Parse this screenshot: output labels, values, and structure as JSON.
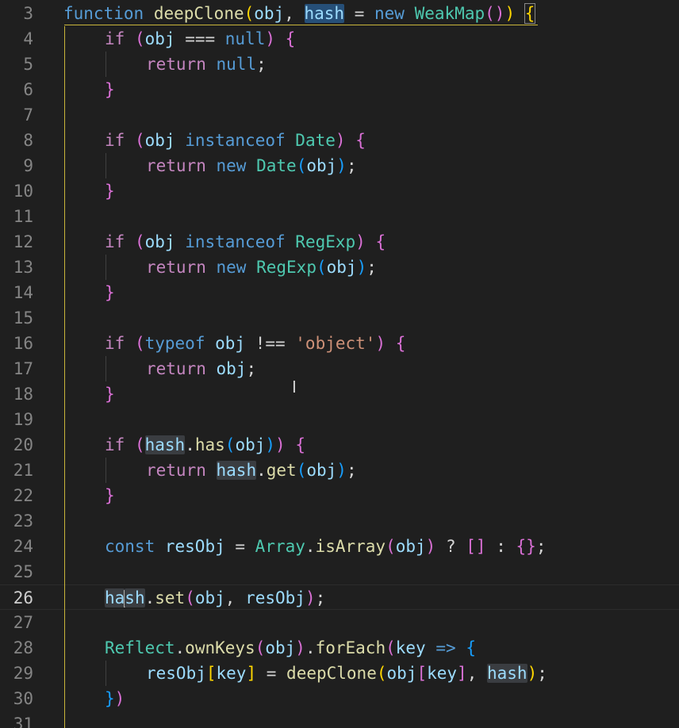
{
  "editor": {
    "language": "javascript",
    "active_line": "26",
    "lines": [
      {
        "num": "3",
        "text": "function deepClone(obj, hash = new WeakMap()) {"
      },
      {
        "num": "4",
        "text": "if (obj === null) {"
      },
      {
        "num": "5",
        "text": "return null;"
      },
      {
        "num": "6",
        "text": "}"
      },
      {
        "num": "7",
        "text": ""
      },
      {
        "num": "8",
        "text": "if (obj instanceof Date) {"
      },
      {
        "num": "9",
        "text": "return new Date(obj);"
      },
      {
        "num": "10",
        "text": "}"
      },
      {
        "num": "11",
        "text": ""
      },
      {
        "num": "12",
        "text": "if (obj instanceof RegExp) {"
      },
      {
        "num": "13",
        "text": "return new RegExp(obj);"
      },
      {
        "num": "14",
        "text": "}"
      },
      {
        "num": "15",
        "text": ""
      },
      {
        "num": "16",
        "text": "if (typeof obj !== 'object') {"
      },
      {
        "num": "17",
        "text": "return obj;"
      },
      {
        "num": "18",
        "text": "}"
      },
      {
        "num": "19",
        "text": ""
      },
      {
        "num": "20",
        "text": "if (hash.has(obj)) {"
      },
      {
        "num": "21",
        "text": "return hash.get(obj);"
      },
      {
        "num": "22",
        "text": "}"
      },
      {
        "num": "23",
        "text": ""
      },
      {
        "num": "24",
        "text": "const resObj = Array.isArray(obj) ? [] : {};"
      },
      {
        "num": "25",
        "text": ""
      },
      {
        "num": "26",
        "text": "hash.set(obj, resObj);"
      },
      {
        "num": "27",
        "text": ""
      },
      {
        "num": "28",
        "text": "Reflect.ownKeys(obj).forEach(key => {"
      },
      {
        "num": "29",
        "text": "resObj[key] = deepClone(obj[key], hash);"
      },
      {
        "num": "30",
        "text": "})"
      },
      {
        "num": "31",
        "text": ""
      }
    ]
  },
  "tokens": {
    "3": [
      {
        "t": "function",
        "c": "kw"
      },
      {
        "t": " "
      },
      {
        "t": "deepClone",
        "c": "fn"
      },
      {
        "t": "(",
        "c": "b1"
      },
      {
        "t": "obj",
        "c": "var"
      },
      {
        "t": ", "
      },
      {
        "t": "hash",
        "c": "var",
        "h": "sel"
      },
      {
        "t": " = "
      },
      {
        "t": "new",
        "c": "kw"
      },
      {
        "t": " "
      },
      {
        "t": "WeakMap",
        "c": "cls"
      },
      {
        "t": "(",
        "c": "b2"
      },
      {
        "t": ")",
        "c": "b2"
      },
      {
        "t": ")",
        "c": "b1"
      },
      {
        "t": " "
      },
      {
        "t": "{",
        "c": "b1",
        "h": "match"
      }
    ],
    "4": [
      {
        "t": "if",
        "c": "ctrl"
      },
      {
        "t": " "
      },
      {
        "t": "(",
        "c": "b2"
      },
      {
        "t": "obj",
        "c": "var"
      },
      {
        "t": " === "
      },
      {
        "t": "null",
        "c": "kw"
      },
      {
        "t": ")",
        "c": "b2"
      },
      {
        "t": " "
      },
      {
        "t": "{",
        "c": "b2"
      }
    ],
    "5": [
      {
        "t": "return",
        "c": "ctrl"
      },
      {
        "t": " "
      },
      {
        "t": "null",
        "c": "kw"
      },
      {
        "t": ";"
      }
    ],
    "6": [
      {
        "t": "}",
        "c": "b2"
      }
    ],
    "8": [
      {
        "t": "if",
        "c": "ctrl"
      },
      {
        "t": " "
      },
      {
        "t": "(",
        "c": "b2"
      },
      {
        "t": "obj",
        "c": "var"
      },
      {
        "t": " "
      },
      {
        "t": "instanceof",
        "c": "kw"
      },
      {
        "t": " "
      },
      {
        "t": "Date",
        "c": "cls"
      },
      {
        "t": ")",
        "c": "b2"
      },
      {
        "t": " "
      },
      {
        "t": "{",
        "c": "b2"
      }
    ],
    "9": [
      {
        "t": "return",
        "c": "ctrl"
      },
      {
        "t": " "
      },
      {
        "t": "new",
        "c": "kw"
      },
      {
        "t": " "
      },
      {
        "t": "Date",
        "c": "cls"
      },
      {
        "t": "(",
        "c": "b3"
      },
      {
        "t": "obj",
        "c": "var"
      },
      {
        "t": ")",
        "c": "b3"
      },
      {
        "t": ";"
      }
    ],
    "10": [
      {
        "t": "}",
        "c": "b2"
      }
    ],
    "12": [
      {
        "t": "if",
        "c": "ctrl"
      },
      {
        "t": " "
      },
      {
        "t": "(",
        "c": "b2"
      },
      {
        "t": "obj",
        "c": "var"
      },
      {
        "t": " "
      },
      {
        "t": "instanceof",
        "c": "kw"
      },
      {
        "t": " "
      },
      {
        "t": "RegExp",
        "c": "cls"
      },
      {
        "t": ")",
        "c": "b2"
      },
      {
        "t": " "
      },
      {
        "t": "{",
        "c": "b2"
      }
    ],
    "13": [
      {
        "t": "return",
        "c": "ctrl"
      },
      {
        "t": " "
      },
      {
        "t": "new",
        "c": "kw"
      },
      {
        "t": " "
      },
      {
        "t": "RegExp",
        "c": "cls"
      },
      {
        "t": "(",
        "c": "b3"
      },
      {
        "t": "obj",
        "c": "var"
      },
      {
        "t": ")",
        "c": "b3"
      },
      {
        "t": ";"
      }
    ],
    "14": [
      {
        "t": "}",
        "c": "b2"
      }
    ],
    "16": [
      {
        "t": "if",
        "c": "ctrl"
      },
      {
        "t": " "
      },
      {
        "t": "(",
        "c": "b2"
      },
      {
        "t": "typeof",
        "c": "kw"
      },
      {
        "t": " "
      },
      {
        "t": "obj",
        "c": "var"
      },
      {
        "t": " !== "
      },
      {
        "t": "'object'",
        "c": "str"
      },
      {
        "t": ")",
        "c": "b2"
      },
      {
        "t": " "
      },
      {
        "t": "{",
        "c": "b2"
      }
    ],
    "17": [
      {
        "t": "return",
        "c": "ctrl"
      },
      {
        "t": " "
      },
      {
        "t": "obj",
        "c": "var"
      },
      {
        "t": ";"
      }
    ],
    "18": [
      {
        "t": "}",
        "c": "b2"
      }
    ],
    "20": [
      {
        "t": "if",
        "c": "ctrl"
      },
      {
        "t": " "
      },
      {
        "t": "(",
        "c": "b2"
      },
      {
        "t": "hash",
        "c": "var",
        "h": "word"
      },
      {
        "t": "."
      },
      {
        "t": "has",
        "c": "fn"
      },
      {
        "t": "(",
        "c": "b3"
      },
      {
        "t": "obj",
        "c": "var"
      },
      {
        "t": ")",
        "c": "b3"
      },
      {
        "t": ")",
        "c": "b2"
      },
      {
        "t": " "
      },
      {
        "t": "{",
        "c": "b2"
      }
    ],
    "21": [
      {
        "t": "return",
        "c": "ctrl"
      },
      {
        "t": " "
      },
      {
        "t": "hash",
        "c": "var",
        "h": "word"
      },
      {
        "t": "."
      },
      {
        "t": "get",
        "c": "fn"
      },
      {
        "t": "(",
        "c": "b3"
      },
      {
        "t": "obj",
        "c": "var"
      },
      {
        "t": ")",
        "c": "b3"
      },
      {
        "t": ";"
      }
    ],
    "22": [
      {
        "t": "}",
        "c": "b2"
      }
    ],
    "24": [
      {
        "t": "const",
        "c": "kw"
      },
      {
        "t": " "
      },
      {
        "t": "resObj",
        "c": "var"
      },
      {
        "t": " = "
      },
      {
        "t": "Array",
        "c": "cls"
      },
      {
        "t": "."
      },
      {
        "t": "isArray",
        "c": "fn"
      },
      {
        "t": "(",
        "c": "b2"
      },
      {
        "t": "obj",
        "c": "var"
      },
      {
        "t": ")",
        "c": "b2"
      },
      {
        "t": " ? "
      },
      {
        "t": "[",
        "c": "b2"
      },
      {
        "t": "]",
        "c": "b2"
      },
      {
        "t": " : "
      },
      {
        "t": "{",
        "c": "b2"
      },
      {
        "t": "}",
        "c": "b2"
      },
      {
        "t": ";"
      }
    ],
    "26": [
      {
        "t": "ha",
        "c": "var",
        "h": "word"
      },
      {
        "caret": true
      },
      {
        "t": "sh",
        "c": "var",
        "h": "word"
      },
      {
        "t": "."
      },
      {
        "t": "set",
        "c": "fn"
      },
      {
        "t": "(",
        "c": "b2"
      },
      {
        "t": "obj",
        "c": "var"
      },
      {
        "t": ", "
      },
      {
        "t": "resObj",
        "c": "var"
      },
      {
        "t": ")",
        "c": "b2"
      },
      {
        "t": ";"
      }
    ],
    "28": [
      {
        "t": "Reflect",
        "c": "cls"
      },
      {
        "t": "."
      },
      {
        "t": "ownKeys",
        "c": "fn"
      },
      {
        "t": "(",
        "c": "b2"
      },
      {
        "t": "obj",
        "c": "var"
      },
      {
        "t": ")",
        "c": "b2"
      },
      {
        "t": "."
      },
      {
        "t": "forEach",
        "c": "fn"
      },
      {
        "t": "(",
        "c": "b2"
      },
      {
        "t": "key",
        "c": "var"
      },
      {
        "t": " "
      },
      {
        "t": "=>",
        "c": "kw"
      },
      {
        "t": " "
      },
      {
        "t": "{",
        "c": "b3"
      }
    ],
    "29": [
      {
        "t": "resObj",
        "c": "var"
      },
      {
        "t": "[",
        "c": "b1"
      },
      {
        "t": "key",
        "c": "var"
      },
      {
        "t": "]",
        "c": "b1"
      },
      {
        "t": " = "
      },
      {
        "t": "deepClone",
        "c": "fn"
      },
      {
        "t": "(",
        "c": "b1"
      },
      {
        "t": "obj",
        "c": "var"
      },
      {
        "t": "[",
        "c": "b2"
      },
      {
        "t": "key",
        "c": "var"
      },
      {
        "t": "]",
        "c": "b2"
      },
      {
        "t": ", "
      },
      {
        "t": "hash",
        "c": "var",
        "h": "word"
      },
      {
        "t": ")",
        "c": "b1"
      },
      {
        "t": ";"
      }
    ],
    "30": [
      {
        "t": "}",
        "c": "b3"
      },
      {
        "t": ")",
        "c": "b2"
      }
    ]
  },
  "indent": {
    "3": 0,
    "4": 1,
    "5": 2,
    "6": 1,
    "8": 1,
    "9": 2,
    "10": 1,
    "12": 1,
    "13": 2,
    "14": 1,
    "16": 1,
    "17": 2,
    "18": 1,
    "20": 1,
    "21": 2,
    "22": 1,
    "24": 1,
    "26": 1,
    "28": 1,
    "29": 2,
    "30": 1
  }
}
